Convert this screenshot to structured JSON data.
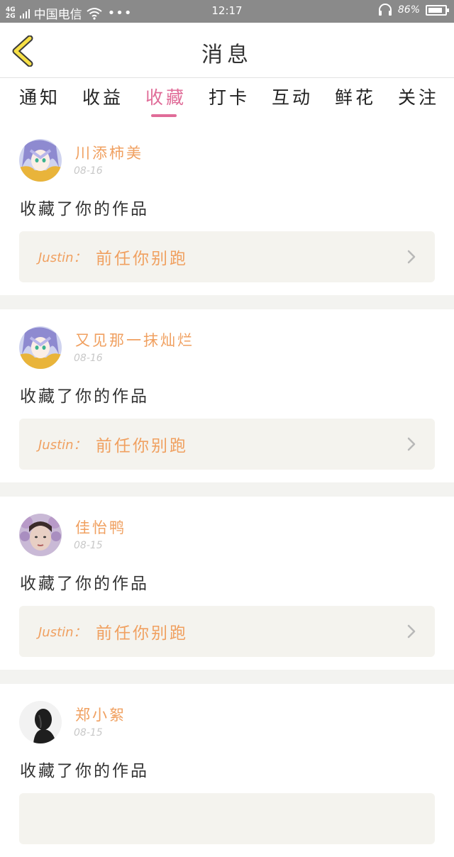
{
  "status_bar": {
    "network_top": "4G",
    "network_bottom": "2G",
    "carrier": "中国电信",
    "more": "•••",
    "time": "12:17",
    "battery_text": "86%",
    "battery_level": 0.86
  },
  "header": {
    "title": "消息",
    "back_icon": "chevron-left-icon"
  },
  "tabs": [
    {
      "label": "通知",
      "active": false
    },
    {
      "label": "收益",
      "active": false
    },
    {
      "label": "收藏",
      "active": true
    },
    {
      "label": "打卡",
      "active": false
    },
    {
      "label": "互动",
      "active": false
    },
    {
      "label": "鲜花",
      "active": false
    },
    {
      "label": "关注",
      "active": false
    }
  ],
  "colors": {
    "accent": "#e06c98",
    "name_color": "#f0a060",
    "card_bg": "#f4f3ee",
    "separator": "#f3f3f0"
  },
  "items": [
    {
      "name": "川添柿美",
      "date": "08-16",
      "action": "收藏了你的作品",
      "author": "Justin：",
      "work": "前任你别跑"
    },
    {
      "name": "又见那一抹灿烂",
      "date": "08-16",
      "action": "收藏了你的作品",
      "author": "Justin：",
      "work": "前任你别跑"
    },
    {
      "name": "佳怡鸭",
      "date": "08-15",
      "action": "收藏了你的作品",
      "author": "Justin：",
      "work": "前任你别跑"
    },
    {
      "name": "郑小絮",
      "date": "08-15",
      "action": "收藏了你的作品",
      "author": "",
      "work": ""
    }
  ]
}
